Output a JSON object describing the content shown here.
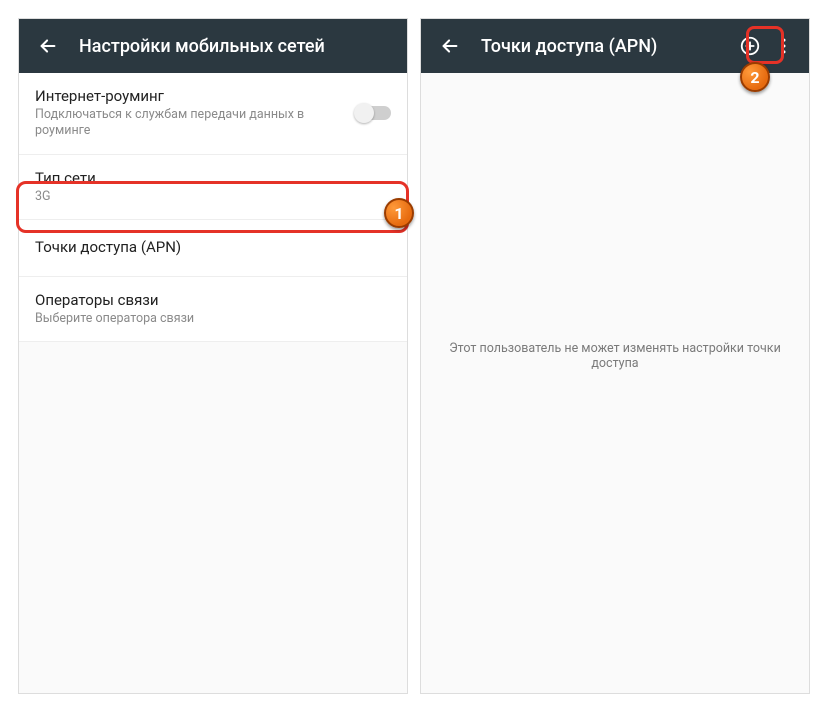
{
  "left": {
    "appbar_title": "Настройки мобильных сетей",
    "roaming": {
      "title": "Интернет-роуминг",
      "subtitle": "Подключаться к службам передачи данных в роуминге"
    },
    "network_type": {
      "title": "Тип сети",
      "subtitle": "3G"
    },
    "apn": {
      "title": "Точки доступа (APN)"
    },
    "operators": {
      "title": "Операторы связи",
      "subtitle": "Выберите оператора связи"
    }
  },
  "right": {
    "appbar_title": "Точки доступа (APN)",
    "empty_message": "Этот пользователь не может изменять настройки точки доступа"
  },
  "badges": {
    "one": "1",
    "two": "2"
  }
}
